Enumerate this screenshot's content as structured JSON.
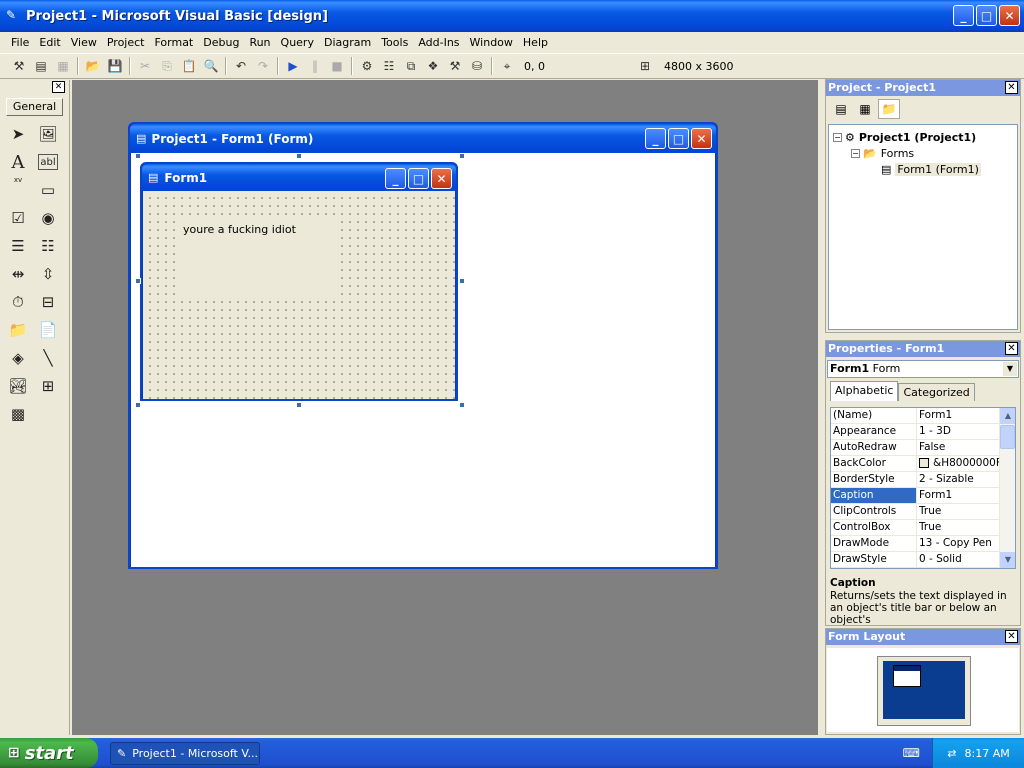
{
  "window": {
    "title": "Project1 - Microsoft Visual Basic [design]"
  },
  "menu": [
    "File",
    "Edit",
    "View",
    "Project",
    "Format",
    "Debug",
    "Run",
    "Query",
    "Diagram",
    "Tools",
    "Add-Ins",
    "Window",
    "Help"
  ],
  "toolbar": {
    "position": "0, 0",
    "size": "4800 x 3600"
  },
  "toolbox": {
    "tab": "General",
    "label_tool": "A",
    "textbox_tool": "abl",
    "frame_tool": "xv"
  },
  "designer": {
    "title": "Project1 - Form1 (Form)"
  },
  "form1": {
    "title": "Form1",
    "label_text": "youre a fucking idiot"
  },
  "project": {
    "title": "Project - Project1",
    "root": "Project1 (Project1)",
    "folder": "Forms",
    "item": "Form1 (Form1)"
  },
  "properties": {
    "title": "Properties - Form1",
    "object_name": "Form1",
    "object_type": "Form",
    "tab_alphabetic": "Alphabetic",
    "tab_categorized": "Categorized",
    "rows": [
      {
        "name": "(Name)",
        "value": "Form1"
      },
      {
        "name": "Appearance",
        "value": "1 - 3D"
      },
      {
        "name": "AutoRedraw",
        "value": "False"
      },
      {
        "name": "BackColor",
        "value": "&H8000000F"
      },
      {
        "name": "BorderStyle",
        "value": "2 - Sizable"
      },
      {
        "name": "Caption",
        "value": "Form1"
      },
      {
        "name": "ClipControls",
        "value": "True"
      },
      {
        "name": "ControlBox",
        "value": "True"
      },
      {
        "name": "DrawMode",
        "value": "13 - Copy Pen"
      },
      {
        "name": "DrawStyle",
        "value": "0 - Solid"
      }
    ],
    "desc_title": "Caption",
    "desc_text": "Returns/sets the text displayed in an object's title bar or below an object's"
  },
  "form_layout": {
    "title": "Form Layout"
  },
  "taskbar": {
    "start": "start",
    "task": "Project1 - Microsoft V...",
    "clock": "8:17 AM"
  }
}
